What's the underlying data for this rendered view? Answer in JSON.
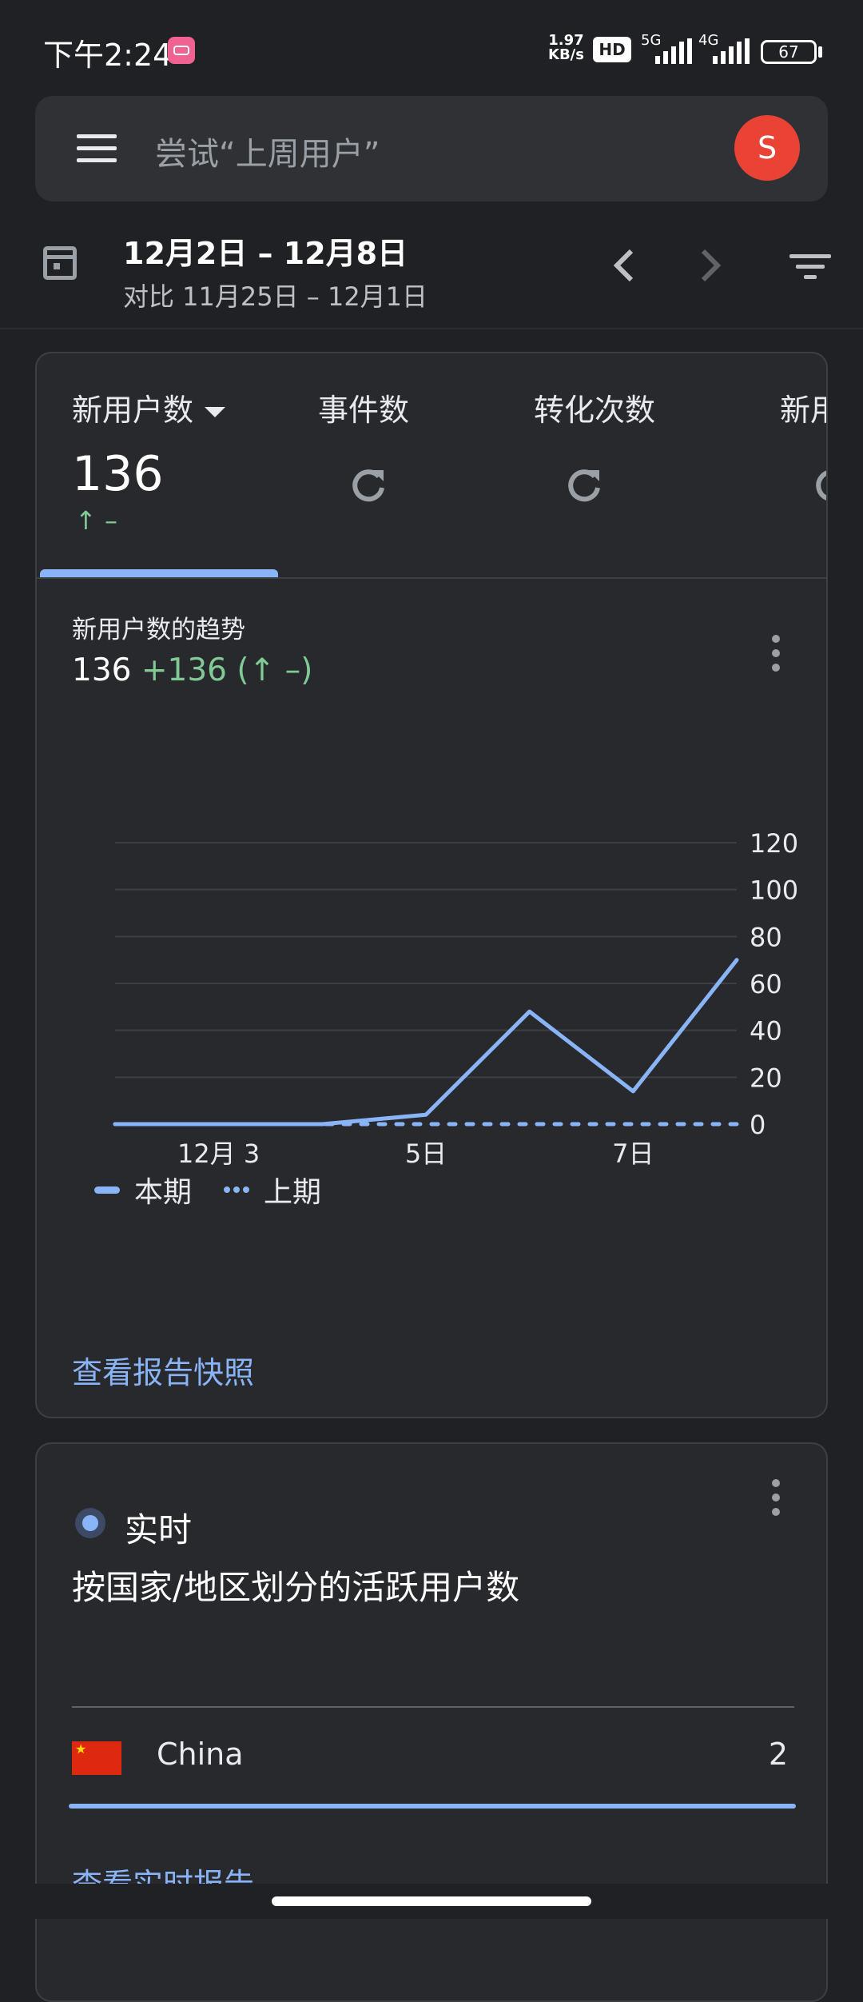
{
  "status_bar": {
    "time": "下午2:24",
    "net_speed_value": "1.97",
    "net_speed_unit": "KB/s",
    "hd_badge": "HD",
    "sim1_label": "5G",
    "sim2_label": "4G",
    "battery": "67"
  },
  "search": {
    "placeholder": "尝试“上周用户”",
    "avatar_letter": "S"
  },
  "date_range": {
    "current": "12月2日 – 12月8日",
    "compare": "对比 11月25日 – 12月1日"
  },
  "metric_tabs": [
    {
      "label": "新用户数",
      "value": "136",
      "change": "↑ –"
    },
    {
      "label": "事件数"
    },
    {
      "label": "转化次数"
    },
    {
      "label": "新用"
    }
  ],
  "trend_card": {
    "title": "新用户数的趋势",
    "total": "136",
    "delta": "+136 (↑ –)",
    "legend_current": "本期",
    "legend_previous": "上期",
    "snapshot_link": "查看报告快照"
  },
  "chart_data": {
    "type": "line",
    "x": [
      "12月2日",
      "12月3日",
      "12月4日",
      "12月5日",
      "12月6日",
      "12月7日",
      "12月8日"
    ],
    "x_tick_labels": [
      "12月 3",
      "5日",
      "7日"
    ],
    "ylim": [
      0,
      120
    ],
    "y_ticks": [
      0,
      20,
      40,
      60,
      80,
      100,
      120
    ],
    "y_axis_position": "right",
    "grid": true,
    "series": [
      {
        "name": "本期",
        "style": "solid",
        "color": "#8ab4f8",
        "values": [
          0,
          0,
          0,
          4,
          48,
          14,
          70
        ]
      },
      {
        "name": "上期",
        "style": "dotted",
        "color": "#8ab4f8",
        "values": [
          0,
          0,
          0,
          0,
          0,
          0,
          0
        ]
      }
    ]
  },
  "realtime_card": {
    "label": "实时",
    "title": "按国家/地区划分的活跃用户数",
    "rows": [
      {
        "country": "China",
        "count": "2"
      }
    ],
    "link": "查看实时报告"
  },
  "colors": {
    "background": "#202124",
    "card": "#28292c",
    "accent": "#8ab4f8",
    "positive": "#81c995",
    "avatar": "#ea4335"
  }
}
